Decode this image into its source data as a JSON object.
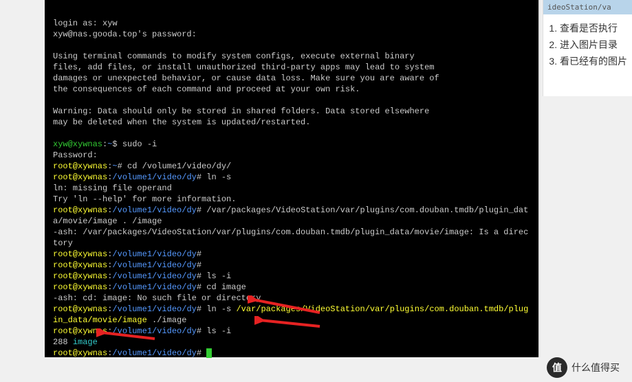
{
  "right_panel": {
    "header": "ideoStation/va",
    "items": [
      "查看是否执行",
      "进入图片目录",
      "看已经有的图片"
    ]
  },
  "terminal": {
    "login_prompt": "login as: ",
    "login_user": "xyw",
    "pw_prompt": "xyw@nas.gooda.top's password:",
    "banner1": "Using terminal commands to modify system configs, execute external binary",
    "banner2": "files, add files, or install unauthorized third-party apps may lead to system",
    "banner3": "damages or unexpected behavior, or cause data loss. Make sure you are aware of",
    "banner4": "the consequences of each command and proceed at your own risk.",
    "warn1": "Warning: Data should only be stored in shared folders. Data stored elsewhere",
    "warn2": "may be deleted when the system is updated/restarted.",
    "user_prompt_user": "xyw@xywnas",
    "user_prompt_tilde": "~",
    "user_prompt_symbol": "$ ",
    "cmd_sudo": "sudo -i",
    "pw_label": "Password:",
    "root_user": "root@xywnas",
    "root_path_tilde": "~",
    "root_symbol": "# ",
    "cmd_cd": "cd /volume1/video/dy/",
    "path_dy": "/volume1/video/dy",
    "cmd_ln1": "ln -s",
    "ln_err1": "ln: missing file operand",
    "ln_err2": "Try 'ln --help' for more information.",
    "cmd_path_long": "/var/packages/VideoStation/var/plugins/com.douban.tmdb/plugin_data/movie/image . /image",
    "ash_err1": "-ash: /var/packages/VideoStation/var/plugins/com.douban.tmdb/plugin_data/movie/image: Is a directory",
    "cmd_ls": "ls -i",
    "cmd_cdimg": "cd image",
    "ash_err2": "-ash: cd: image: No such file or directory",
    "cmd_ln2a": "ln -s ",
    "cmd_ln2_target": "/var/packages/VideoStation/var/plugins/com.douban.tmdb/plugin_data/movie/image",
    "cmd_ln2_link": " ./image",
    "ls_num": "288 ",
    "ls_name": "image"
  },
  "badge": {
    "circ": "值",
    "text": "什么值得买"
  }
}
